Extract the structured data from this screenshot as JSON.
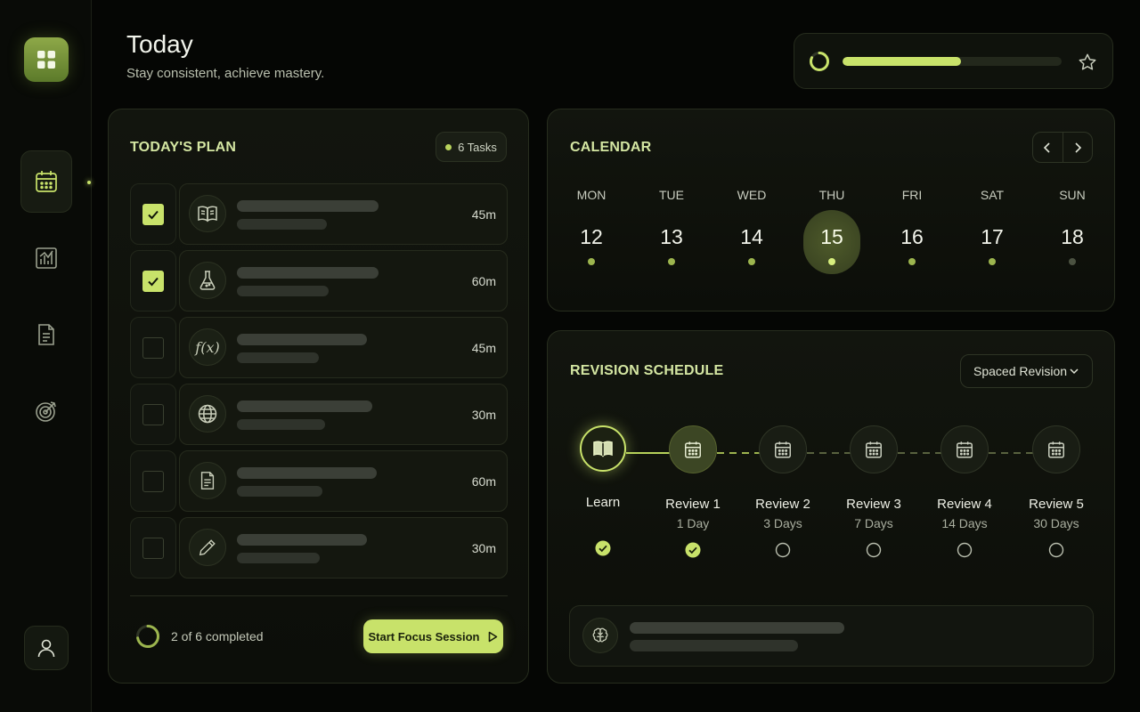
{
  "header": {
    "title": "Today",
    "subtitle": "Stay consistent, achieve mastery.",
    "daily_progress": 0.54
  },
  "sidebar": {
    "items": [
      {
        "icon": "calendar-icon",
        "active": true
      },
      {
        "icon": "chart-icon",
        "active": false
      },
      {
        "icon": "document-icon",
        "active": false
      },
      {
        "icon": "target-icon",
        "active": false
      }
    ]
  },
  "plan": {
    "title": "TODAY'S PLAN",
    "tasks_badge": "6 Tasks",
    "tasks": [
      {
        "icon": "book-icon",
        "duration": "45m",
        "checked": true
      },
      {
        "icon": "flask-icon",
        "duration": "60m",
        "checked": true
      },
      {
        "icon": "function-icon",
        "icon_text": "f(x)",
        "duration": "45m",
        "checked": false
      },
      {
        "icon": "globe-icon",
        "duration": "30m",
        "checked": false
      },
      {
        "icon": "document-icon",
        "duration": "60m",
        "checked": false
      },
      {
        "icon": "pencil-icon",
        "duration": "30m",
        "checked": false
      }
    ],
    "completed_text": "2 of 6 completed",
    "completed_fraction": 0.333,
    "focus_button": "Start Focus Session"
  },
  "calendar": {
    "title": "CALENDAR",
    "days": [
      {
        "name": "MON",
        "num": "12",
        "today": false,
        "dot": "bright"
      },
      {
        "name": "TUE",
        "num": "13",
        "today": false,
        "dot": "bright"
      },
      {
        "name": "WED",
        "num": "14",
        "today": false,
        "dot": "bright"
      },
      {
        "name": "THU",
        "num": "15",
        "today": true,
        "dot": "bright"
      },
      {
        "name": "FRI",
        "num": "16",
        "today": false,
        "dot": "bright"
      },
      {
        "name": "SAT",
        "num": "17",
        "today": false,
        "dot": "bright"
      },
      {
        "name": "SUN",
        "num": "18",
        "today": false,
        "dot": "dim"
      }
    ]
  },
  "revision": {
    "title": "REVISION SCHEDULE",
    "mode": "Spaced Revision",
    "stages": [
      {
        "label": "Learn",
        "sub": "",
        "done": true
      },
      {
        "label": "Review 1",
        "sub": "1 Day",
        "done": true
      },
      {
        "label": "Review 2",
        "sub": "3 Days",
        "done": false
      },
      {
        "label": "Review 3",
        "sub": "7 Days",
        "done": false
      },
      {
        "label": "Review 4",
        "sub": "14 Days",
        "done": false
      },
      {
        "label": "Review 5",
        "sub": "30 Days",
        "done": false
      }
    ]
  },
  "colors": {
    "accent": "#c8e26a",
    "background": "#050604",
    "card": "#12150e"
  }
}
